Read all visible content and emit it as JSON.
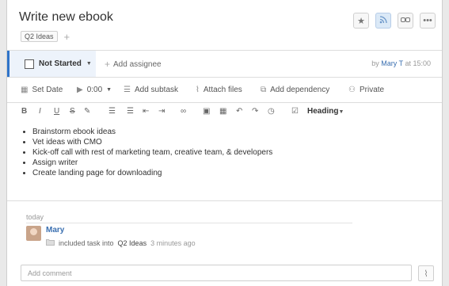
{
  "task": {
    "title": "Write new ebook",
    "tag": "Q2 Ideas",
    "status": "Not Started",
    "add_assignee": "Add assignee",
    "by_prefix": "by",
    "by_name": "Mary T",
    "by_suffix": "at 15:00"
  },
  "toolbar": {
    "set_date": "Set Date",
    "timer": "0:00",
    "add_subtask": "Add subtask",
    "attach_files": "Attach files",
    "add_dependency": "Add dependency",
    "private": "Private"
  },
  "format": {
    "bold": "B",
    "italic": "I",
    "underline": "U",
    "strike": "S",
    "heading": "Heading"
  },
  "description": {
    "items": [
      "Brainstorm ebook ideas",
      "Vet ideas with CMO",
      "Kick-off call with rest of marketing team, creative team, & developers",
      "Assign writer",
      "Create landing page for downloading"
    ]
  },
  "activity": {
    "day": "today",
    "user": "Mary",
    "action": "included task into",
    "project": "Q2 Ideas",
    "time": "3 minutes ago"
  },
  "comment": {
    "placeholder": "Add comment"
  },
  "colors": {
    "accent": "#2f74c9",
    "link": "#3a6fb0"
  }
}
